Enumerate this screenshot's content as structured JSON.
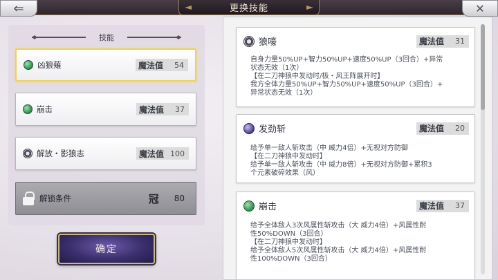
{
  "header": {
    "title": "更换技能",
    "back_glyph": "⇐",
    "close_glyph": "✕"
  },
  "colors": {
    "selected_border": "#f1ce5c",
    "confirm_bg": "#3b2f6e",
    "mana_bg": "#dcdcdc"
  },
  "skills_panel": {
    "title": "技能",
    "items": [
      {
        "name": "凶狼薙",
        "icon": "green-orb-icon",
        "mana_label": "魔法值",
        "mana": "54",
        "selected": true
      },
      {
        "name": "崩击",
        "icon": "green-orb-icon",
        "mana_label": "魔法值",
        "mana": "37",
        "selected": false
      },
      {
        "name": "解放・影狼志",
        "icon": "crest-icon",
        "mana_label": "魔法值",
        "mana": "100",
        "selected": false
      }
    ],
    "unlock": {
      "label": "解锁条件",
      "icon": "lock-icon",
      "crown_glyph": "冠",
      "value": "80"
    },
    "confirm_label": "确定"
  },
  "details": [
    {
      "name": "狼嚎",
      "icon": "crest-icon",
      "mana_label": "魔法值",
      "mana": "31",
      "lines": [
        "自身力量50%UP+智力50%UP+速度50%UP（3回合）+异常",
        "状态无效（1次）",
        "【在二刀神狼中发动时/极・风王阵展开时】",
        "我方全体力量50%UP+智力50%UP+速度50%UP（3回合）+",
        "异常状态无效（1次）"
      ]
    },
    {
      "name": "发劲斩",
      "icon": "purple-orb-icon",
      "mana_label": "魔法值",
      "mana": "20",
      "lines": [
        "给予单一敌人斩攻击（中    威力4倍）+无视对方防御",
        "【在二刀神狼中发动时】",
        "给予单一敌人斩攻击（中    威力8倍）+无视对方防御+累积3",
        "个元素破碎效果（风）"
      ]
    },
    {
      "name": "崩击",
      "icon": "green-orb-icon",
      "mana_label": "魔法值",
      "mana": "37",
      "lines": [
        "给予全体敌人3次风属性斩攻击（大    威力4倍）+风属性耐",
        "性50%DOWN（3回合）",
        "【在二刀神狼中发动时】",
        "给予全体敌人5次风属性斩攻击（大    威力4倍）+风属性耐",
        "性100%DOWN（3回合）"
      ]
    }
  ]
}
